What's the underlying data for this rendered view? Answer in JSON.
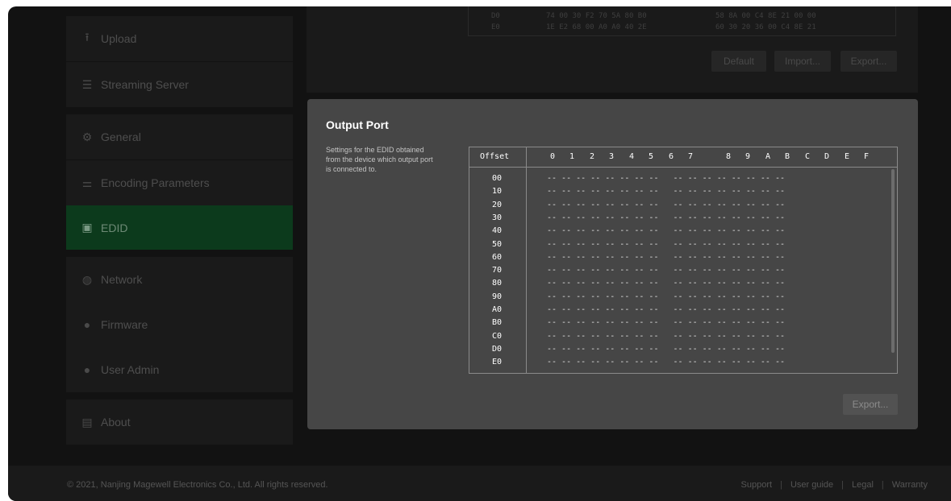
{
  "sidebar": {
    "items": [
      {
        "label": "Upload",
        "icon": "upload-icon",
        "glyph": "⭱",
        "active": false
      },
      {
        "label": "Streaming Server",
        "icon": "server-icon",
        "glyph": "☰",
        "active": false
      },
      {
        "label": "General",
        "icon": "gear-icon",
        "glyph": "⚙",
        "active": false
      },
      {
        "label": "Encoding Parameters",
        "icon": "sliders-icon",
        "glyph": "⚌",
        "active": false
      },
      {
        "label": "EDID",
        "icon": "edid-icon",
        "glyph": "▣",
        "active": true
      },
      {
        "label": "Network",
        "icon": "globe-icon",
        "glyph": "◍",
        "active": false
      },
      {
        "label": "Firmware",
        "icon": "info-icon",
        "glyph": "●",
        "active": false
      },
      {
        "label": "User Admin",
        "icon": "user-icon",
        "glyph": "●",
        "active": false
      },
      {
        "label": "About",
        "icon": "document-icon",
        "glyph": "▤",
        "active": false
      }
    ]
  },
  "top_panel": {
    "rows": [
      {
        "offset": "D0",
        "bytes_a": "74 00 30 F2 70 5A 80 B0",
        "bytes_b": "58 8A 00 C4 8E 21 00 00"
      },
      {
        "offset": "E0",
        "bytes_a": "1E E2 68 00 A0 A0 40 2E",
        "bytes_b": "60 30 20 36 00 C4 8E 21"
      }
    ],
    "buttons": {
      "default": "Default",
      "import": "Import...",
      "export": "Export..."
    }
  },
  "modal": {
    "title": "Output Port",
    "description": "Settings for the EDID obtained from the device which output port is connected to.",
    "table": {
      "offset_header": "Offset",
      "columns": [
        "0",
        "1",
        "2",
        "3",
        "4",
        "5",
        "6",
        "7",
        "8",
        "9",
        "A",
        "B",
        "C",
        "D",
        "E",
        "F"
      ],
      "offsets": [
        "00",
        "10",
        "20",
        "30",
        "40",
        "50",
        "60",
        "70",
        "80",
        "90",
        "A0",
        "B0",
        "C0",
        "D0",
        "E0"
      ],
      "empty_cell": "--"
    },
    "export_label": "Export..."
  },
  "footer": {
    "copyright": "© 2021, Nanjing Magewell Electronics Co., Ltd. All rights reserved.",
    "links": [
      "Support",
      "User guide",
      "Legal",
      "Warranty"
    ]
  }
}
